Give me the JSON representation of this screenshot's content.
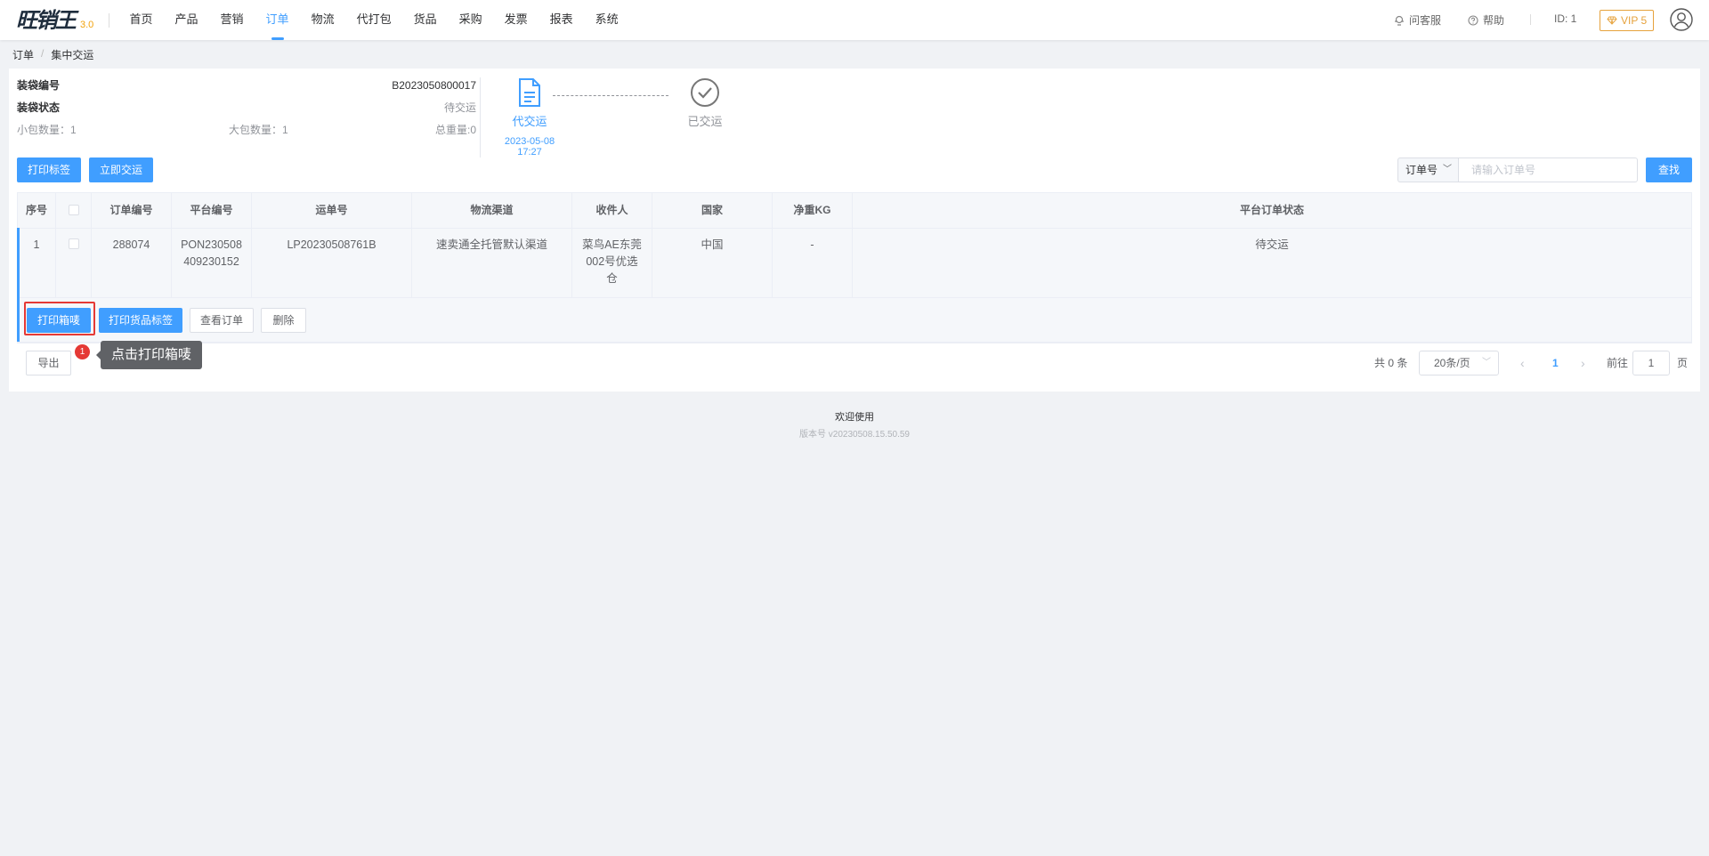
{
  "app": {
    "logo_text": "旺销王",
    "logo_version": "3.0"
  },
  "nav": {
    "items": [
      {
        "label": "首页"
      },
      {
        "label": "产品"
      },
      {
        "label": "营销"
      },
      {
        "label": "订单",
        "active": true
      },
      {
        "label": "物流"
      },
      {
        "label": "代打包"
      },
      {
        "label": "货品"
      },
      {
        "label": "采购"
      },
      {
        "label": "发票"
      },
      {
        "label": "报表"
      },
      {
        "label": "系统"
      }
    ],
    "customer_service": "问客服",
    "help": "帮助",
    "user_id": "ID: 1",
    "vip": "VIP 5",
    "accent_color": "#409eff",
    "vip_color": "#e6a23c"
  },
  "breadcrumb": {
    "items": [
      "订单",
      "集中交运"
    ],
    "separator": "/"
  },
  "bag": {
    "number_label": "装袋编号",
    "number_value": "B2023050800017",
    "status_label": "装袋状态",
    "status_value": "待交运",
    "small_count": "小包数量：1",
    "large_count": "大包数量：1",
    "total_weight": "总重量:0"
  },
  "steps": [
    {
      "title": "代交运",
      "date": "2023-05-08",
      "time": "17:27",
      "icon": "document-icon",
      "state": "active"
    },
    {
      "title": "已交运",
      "icon": "check-circle-icon",
      "state": "pending"
    }
  ],
  "toolbar": {
    "print_label": "打印标签",
    "ship_now": "立即交运",
    "search_field": "订单号",
    "search_placeholder": "请输入订单号",
    "search_button": "查找"
  },
  "table": {
    "headers": [
      "序号",
      "",
      "订单编号",
      "平台编号",
      "运单号",
      "物流渠道",
      "收件人",
      "国家",
      "净重KG",
      "平台订单状态"
    ],
    "rows": [
      {
        "index": "1",
        "order_no": "288074",
        "platform_no_line1": "PON230508",
        "platform_no_line2": "409230152",
        "tracking_no": "LP20230508761B",
        "channel": "速卖通全托管默认渠道",
        "recipient_line1": "菜鸟AE东莞",
        "recipient_line2": "002号优选",
        "recipient_line3": "仓",
        "country": "中国",
        "weight": "-",
        "status": "待交运"
      }
    ],
    "row_actions": {
      "print_box": "打印箱唛",
      "print_goods": "打印货品标签",
      "view_order": "查看订单",
      "delete": "删除"
    }
  },
  "footer_bar": {
    "export": "导出",
    "total": "共 0 条",
    "page_size": "20条/页",
    "current_page": "1",
    "goto_label": "前往",
    "goto_value": "1",
    "page_unit": "页"
  },
  "annotation": {
    "badge": "1",
    "tooltip": "点击打印箱唛",
    "highlight_color": "#e53935"
  },
  "footer": {
    "welcome": "欢迎使用",
    "version": "版本号 v20230508.15.50.59"
  }
}
